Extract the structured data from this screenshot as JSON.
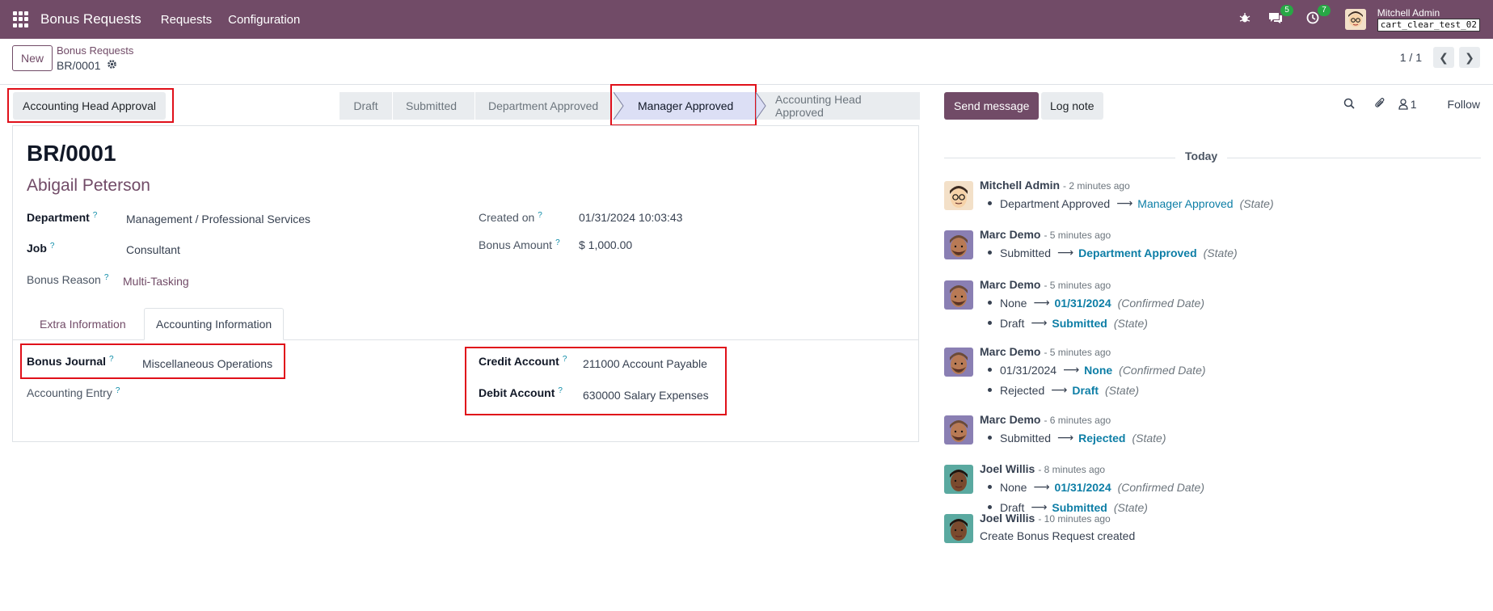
{
  "navbar": {
    "brand": "Bonus Requests",
    "menu": [
      "Requests",
      "Configuration"
    ],
    "chat_count": "5",
    "activity_count": "7",
    "user_name": "Mitchell Admin",
    "db_name": "cart_clear_test_02"
  },
  "control": {
    "new_label": "New",
    "breadcrumb_parent": "Bonus Requests",
    "breadcrumb_current": "BR/0001",
    "pager": "1 / 1"
  },
  "actions": {
    "accounting_head_approval": "Accounting Head Approval"
  },
  "statusbar": {
    "stages": [
      "Draft",
      "Submitted",
      "Department Approved",
      "Manager Approved",
      "Accounting Head Approved"
    ],
    "active": "Manager Approved"
  },
  "form": {
    "record_name": "BR/0001",
    "employee": "Abigail Peterson",
    "department_label": "Department",
    "department": "Management / Professional Services",
    "job_label": "Job",
    "job": "Consultant",
    "bonus_reason_label": "Bonus Reason",
    "bonus_reason": "Multi-Tasking",
    "created_on_label": "Created on",
    "created_on": "01/31/2024 10:03:43",
    "bonus_amount_label": "Bonus Amount",
    "bonus_amount": "$ 1,000.00",
    "tabs": [
      "Extra Information",
      "Accounting Information"
    ],
    "bonus_journal_label": "Bonus Journal",
    "bonus_journal": "Miscellaneous Operations",
    "accounting_entry_label": "Accounting Entry",
    "credit_account_label": "Credit Account",
    "credit_account": "211000 Account Payable",
    "debit_account_label": "Debit Account",
    "debit_account": "630000 Salary Expenses",
    "help_mark": "?"
  },
  "chatter": {
    "send_message": "Send message",
    "log_note": "Log note",
    "followers_count": "1",
    "follow": "Follow",
    "today": "Today",
    "messages": [
      {
        "author": "Mitchell Admin",
        "time": "- 2 minutes ago",
        "lines": [
          {
            "old": "Department Approved",
            "new": "Manager Approved",
            "field": "(State)"
          }
        ]
      },
      {
        "author": "Marc Demo",
        "time": "- 5 minutes ago",
        "lines": [
          {
            "old": "Submitted",
            "new": "Department Approved",
            "field": "(State)"
          }
        ]
      },
      {
        "author": "Marc Demo",
        "time": "- 5 minutes ago",
        "lines": [
          {
            "old": "None",
            "new": "01/31/2024",
            "field": "(Confirmed Date)"
          },
          {
            "old": "Draft",
            "new": "Submitted",
            "field": "(State)"
          }
        ]
      },
      {
        "author": "Marc Demo",
        "time": "- 5 minutes ago",
        "lines": [
          {
            "old": "01/31/2024",
            "new": "None",
            "field": "(Confirmed Date)"
          },
          {
            "old": "Rejected",
            "new": "Draft",
            "field": "(State)"
          }
        ]
      },
      {
        "author": "Marc Demo",
        "time": "- 6 minutes ago",
        "lines": [
          {
            "old": "Submitted",
            "new": "Rejected",
            "field": "(State)"
          }
        ]
      },
      {
        "author": "Joel Willis",
        "time": "- 8 minutes ago",
        "lines": [
          {
            "old": "None",
            "new": "01/31/2024",
            "field": "(Confirmed Date)"
          },
          {
            "old": "Draft",
            "new": "Submitted",
            "field": "(State)"
          }
        ]
      },
      {
        "author": "Joel Willis",
        "time": "- 10 minutes ago",
        "body": "Create Bonus Request created"
      }
    ]
  }
}
